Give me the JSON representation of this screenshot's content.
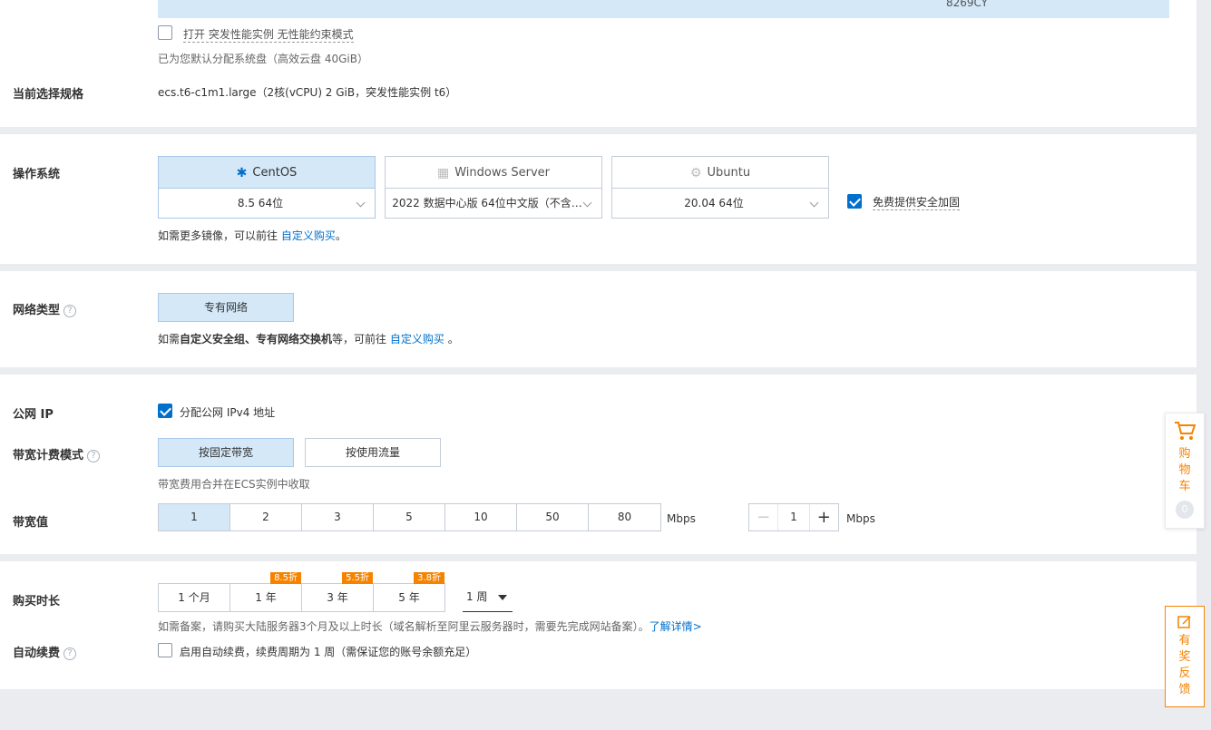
{
  "top": {
    "slider_value": "8269CY",
    "burst_checkbox": {
      "prefix": "打开",
      "label": "突发性能实例 无性能约束模式",
      "checked": false
    },
    "disk_note": "已为您默认分配系统盘（高效云盘 40GiB）",
    "spec_label": "当前选择规格",
    "spec_value": "ecs.t6-c1m1.large（2核(vCPU) 2 GiB，突发性能实例 t6）"
  },
  "os": {
    "label": "操作系统",
    "cards": [
      {
        "name": "CentOS",
        "version": "8.5 64位",
        "icon": "centos-icon",
        "selected": true
      },
      {
        "name": "Windows Server",
        "version": "2022 数据中心版 64位中文版（不含…",
        "icon": "windows-icon",
        "selected": false
      },
      {
        "name": "Ubuntu",
        "version": "20.04 64位",
        "icon": "ubuntu-icon",
        "selected": false
      }
    ],
    "security": {
      "label": "免费提供安全加固",
      "checked": true
    },
    "more_note": "如需更多镜像，可以前往",
    "more_link": "自定义购买",
    "more_end": "。"
  },
  "network": {
    "label": "网络类型",
    "vpc_button": "专有网络",
    "note_pre": "如需",
    "note_bold": "自定义安全组、专有网络交换机",
    "note_mid": "等，可前往",
    "note_link": "自定义购买",
    "note_end": "。"
  },
  "public_ip": {
    "label": "公网 IP",
    "checkbox_label": "分配公网 IPv4 地址",
    "checked": true
  },
  "billing": {
    "label": "带宽计费模式",
    "options": [
      "按固定带宽",
      "按使用流量"
    ],
    "selected_index": 0,
    "note": "带宽费用合并在ECS实例中收取"
  },
  "bandwidth": {
    "label": "带宽值",
    "options": [
      "1",
      "2",
      "3",
      "5",
      "10",
      "50",
      "80"
    ],
    "selected_index": 0,
    "unit": "Mbps",
    "stepper_minus": "−",
    "stepper_value": "1",
    "stepper_plus": "+",
    "stepper_unit": "Mbps"
  },
  "duration": {
    "label": "购买时长",
    "options": [
      {
        "label": "1 个月",
        "discount": ""
      },
      {
        "label": "1 年",
        "discount": "8.5折"
      },
      {
        "label": "3 年",
        "discount": "5.5折"
      },
      {
        "label": "5 年",
        "discount": "3.8折"
      }
    ],
    "week_select": "1 周",
    "note": "如需备案，请购买大陆服务器3个月及以上时长（域名解析至阿里云服务器时，需要先完成网站备案）。",
    "note_link": "了解详情>"
  },
  "renew": {
    "label": "自动续费",
    "checkbox_label": "启用自动续费，续费周期为 1 周（需保证您的账号余额充足）",
    "checked": false
  },
  "side": {
    "cart_label": "购物车",
    "cart_count": "0",
    "feedback_label": "有奖反馈"
  },
  "colors": {
    "accent": "#0070cc",
    "selected_bg": "#d4e8f8",
    "orange": "#f68300"
  }
}
